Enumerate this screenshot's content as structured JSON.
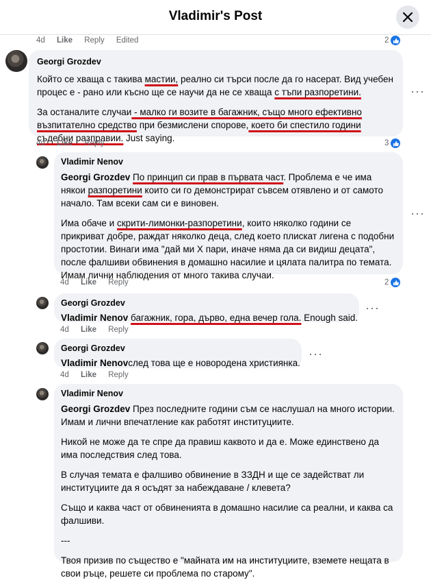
{
  "header": {
    "title": "Vladimir's Post"
  },
  "top_actions": {
    "time": "4d",
    "like": "Like",
    "reply": "Reply",
    "edited": "Edited",
    "reactions": "2"
  },
  "comments": [
    {
      "author": "Georgi Grozdev",
      "p1_a": "Който се хваща с такива ",
      "p1_b": "мастии,",
      "p1_c": " реално си търси после да го насерат. Вид учебен процес е - рано или късно ще се научи да не се хваща ",
      "p1_d": "с тъпи разпоретини.",
      "p2_a": "За останалите случаи",
      "p2_b": " - малко ги возите в багажник, също много ефективно възпитателно средство",
      "p2_c": " при безмислени спорове,",
      "p2_d": " което би спестило години съдебни разправии.",
      "p2_e": " Just saying.",
      "time": "4d",
      "like": "Like",
      "reply": "Reply",
      "reactions": "3"
    },
    {
      "author": "Vladimir Nenov",
      "mention": "Georgi Grozdev",
      "p1_a": "По принцип си прав в първата част",
      "p1_b": ". Проблема е че има някои ",
      "p1_c": "разпоретини",
      "p1_d": " които си го демонстрират съвсем отявлено и от самото начало. Там всеки сам си е виновен.",
      "p2_a": "Има обаче и ",
      "p2_b": "скрити-лимонки-разпоретини",
      "p2_c": ", които няколко години се прикриват добре, раждат няколко деца, след което плискат лигена с подобни простотии. Винаги има \"дай ми X пари, иначе няма да си видиш децата\", после фалшиви обвинения в домашно насилие и цялата палитра по темата. Имам лични наблюдения от много такива случаи.",
      "time": "4d",
      "like": "Like",
      "reply": "Reply",
      "reactions": "2"
    },
    {
      "author": "Georgi Grozdev",
      "mention": "Vladimir Nenov",
      "text_ul": "багажник, гора, дърво, една вечер гола.",
      "text_rest": " Enough said.",
      "time": "4d",
      "like": "Like",
      "reply": "Reply"
    },
    {
      "author": "Georgi Grozdev",
      "mention": "Vladimir Nenov",
      "text": "след това ще е новородена християнка.",
      "time": "4d",
      "like": "Like",
      "reply": "Reply"
    },
    {
      "author": "Vladimir Nenov",
      "mention": "Georgi Grozdev",
      "p1": " През последните години съм се наслушал на много истории. Имам и лични впечатление как работят институциите.",
      "p2": "Никой не може да те спре да правиш каквото и да е. Може единствено да има последствия след това.",
      "p3": "В случая темата е фалшиво обвинение в ЗЗДН и ще се задействат ли институциите да я осъдят за набеждаване / клевета?",
      "p4": "Също и каква част от обвиненията в домашно насилие са реални, и каква са фалшиви.",
      "p5": "---",
      "p6": "Твоя призив по същество е \"майната им на институциите, вземете нещата в свои ръце, решете си проблема по старому\"."
    }
  ],
  "more_icon": "more-horizontal-icon",
  "colors": {
    "bubble": "#f0f2f5",
    "like": "#1b74e4",
    "underline": "#d0101a"
  }
}
